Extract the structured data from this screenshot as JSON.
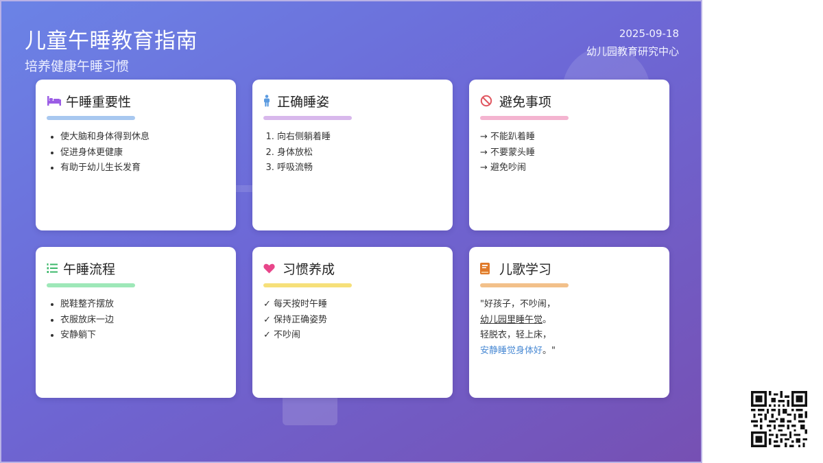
{
  "header": {
    "title": "儿童午睡教育指南",
    "subtitle": "培养健康午睡习惯",
    "date": "2025-09-18",
    "organization": "幼儿园教育研究中心"
  },
  "colors": {
    "background_start": "#6b83e6",
    "background_end": "#7650b3",
    "accent_importance": "#a8c8f0",
    "accent_posture": "#d8b8ec",
    "accent_avoid": "#f4b4d0",
    "accent_process": "#9ee8b8",
    "accent_habit": "#f6e07a",
    "accent_song": "#f2c08a"
  },
  "cards": {
    "importance": {
      "icon": "bed-icon",
      "title": "午睡重要性",
      "items": [
        "使大脑和身体得到休息",
        "促进身体更健康",
        "有助于幼儿生长发育"
      ]
    },
    "posture": {
      "icon": "person-icon",
      "title": "正确睡姿",
      "items": [
        "向右侧躺着睡",
        "身体放松",
        "呼吸流畅"
      ]
    },
    "avoid": {
      "icon": "ban-icon",
      "title": "避免事项",
      "items": [
        "→ 不能趴着睡",
        "→ 不要蒙头睡",
        "→ 避免吵闹"
      ]
    },
    "process": {
      "icon": "list-ordered-icon",
      "title": "午睡流程",
      "items": [
        "脱鞋整齐摆放",
        "衣服放床一边",
        "安静躺下"
      ]
    },
    "habit": {
      "icon": "heart-icon",
      "title": "习惯养成",
      "items": [
        "✓ 每天按时午睡",
        "✓ 保持正确姿势",
        "✓ 不吵闹"
      ]
    },
    "song": {
      "icon": "book-icon",
      "title": "儿歌学习",
      "line1": "\"好孩子，不吵闹，",
      "line2_main": "幼儿园里睡午觉",
      "line2_end": "。",
      "line3": "轻脱衣，轻上床，",
      "line4_main": "安静睡觉身体好",
      "line4_end": "。\""
    }
  }
}
